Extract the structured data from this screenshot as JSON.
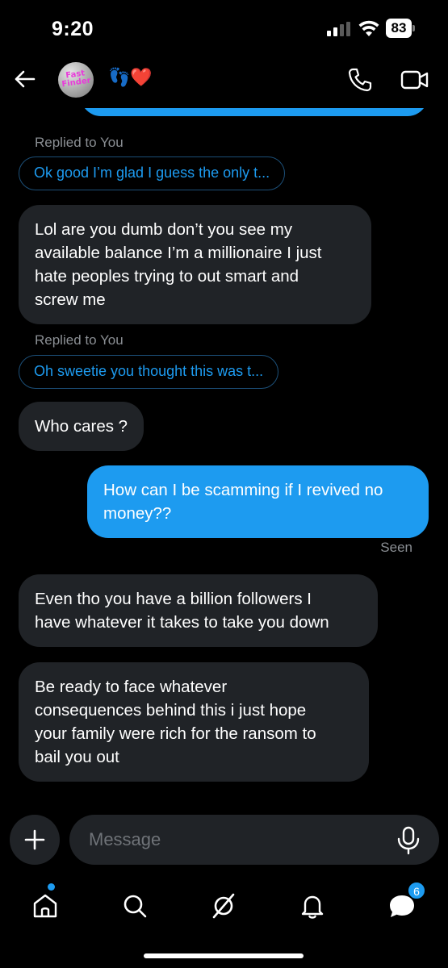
{
  "status_bar": {
    "time": "9:20",
    "battery": "83"
  },
  "header": {
    "avatar_text": "Fast Finder",
    "contact_name": "👣❤️"
  },
  "messages": [
    {
      "type": "reply_label",
      "text": "Replied to You"
    },
    {
      "type": "reply_preview",
      "text": "Ok good I’m glad I guess the only t..."
    },
    {
      "type": "incoming",
      "lines": [
        "Lol are you dumb don’t you see my",
        "available balance I’m a millionaire I just",
        "hate peoples trying to out smart and",
        "screw me"
      ]
    },
    {
      "type": "reply_label",
      "text": "Replied to You"
    },
    {
      "type": "reply_preview",
      "text": "Oh sweetie you thought this was t..."
    },
    {
      "type": "incoming",
      "lines": [
        "Who cares ?"
      ]
    },
    {
      "type": "outgoing",
      "lines": [
        "How can I be scamming if I revived no",
        "money??"
      ]
    },
    {
      "type": "seen",
      "text": "Seen"
    },
    {
      "type": "incoming",
      "lines": [
        "Even tho you have a billion followers I",
        "have whatever it takes to take you down"
      ]
    },
    {
      "type": "incoming",
      "lines": [
        "Be ready to face whatever",
        "consequences behind this i just hope",
        "your family were rich for the ransom to",
        "bail you out"
      ]
    }
  ],
  "composer": {
    "placeholder": "Message"
  },
  "bottom_nav": {
    "items": [
      "home-icon",
      "search-icon",
      "grok-icon",
      "notifications-icon",
      "messages-icon"
    ],
    "messages_badge": "6"
  },
  "colors": {
    "accent": "#1d9bf0",
    "bubble_in": "#202327",
    "background": "#000000",
    "muted": "#8b8f94"
  }
}
